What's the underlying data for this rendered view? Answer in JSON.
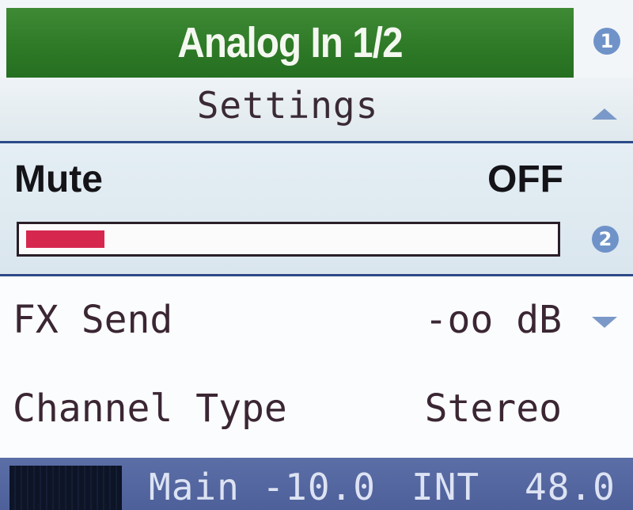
{
  "header": {
    "title": "Analog In 1/2",
    "page_badge": "1"
  },
  "section": {
    "label": "Settings",
    "scroll_up_icon": "arrow-up-icon"
  },
  "mute": {
    "label": "Mute",
    "value": "OFF",
    "level_fraction": 0.15,
    "level_color": "#d6284f",
    "knob_badge": "2"
  },
  "fx_send": {
    "label": "FX Send",
    "value": "-oo dB",
    "scroll_down_icon": "arrow-down-icon"
  },
  "channel_type": {
    "label": "Channel Type",
    "value": "Stereo"
  },
  "status": {
    "main": "Main -10.0",
    "clock": "INT",
    "rate": "48.0"
  },
  "colors": {
    "title_bar": "#2e7a27",
    "status_bar": "#5b6ea6",
    "divider": "#2c4a88",
    "badge": "#6f93c9"
  }
}
